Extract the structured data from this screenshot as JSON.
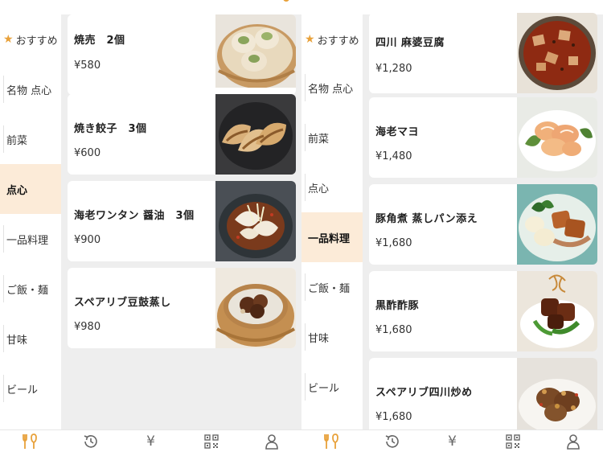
{
  "left": {
    "sidebar": {
      "items": [
        {
          "label": "おすすめ",
          "starred": true
        },
        {
          "label": "名物 点心"
        },
        {
          "label": "前菜"
        },
        {
          "label": "点心",
          "active": true
        },
        {
          "label": "一品料理"
        },
        {
          "label": "ご飯・麺"
        },
        {
          "label": "甘味"
        },
        {
          "label": "ビール"
        }
      ]
    },
    "items": [
      {
        "name": "焼売　2個",
        "price": "¥580",
        "photo": "shumai-photo"
      },
      {
        "name": "焼き餃子　3個",
        "price": "¥600",
        "photo": "gyoza-photo"
      },
      {
        "name": "海老ワンタン 醤油　3個",
        "price": "¥900",
        "photo": "shrimp-wonton-photo"
      },
      {
        "name": "スペアリブ豆鼓蒸し",
        "price": "¥980",
        "photo": "spare-rib-steamed-photo"
      }
    ]
  },
  "right": {
    "sidebar": {
      "items": [
        {
          "label": "おすすめ",
          "starred": true
        },
        {
          "label": "名物 点心"
        },
        {
          "label": "前菜"
        },
        {
          "label": "点心"
        },
        {
          "label": "一品料理",
          "active": true
        },
        {
          "label": "ご飯・麺"
        },
        {
          "label": "甘味"
        },
        {
          "label": "ビール"
        }
      ]
    },
    "items": [
      {
        "name": "四川 麻婆豆腐",
        "price": "¥1,280",
        "photo": "mapo-tofu-photo"
      },
      {
        "name": "海老マヨ",
        "price": "¥1,480",
        "photo": "shrimp-mayo-photo"
      },
      {
        "name": "豚角煮 蒸しパン添え",
        "price": "¥1,680",
        "photo": "braised-pork-photo"
      },
      {
        "name": "黒酢酢豚",
        "price": "¥1,680",
        "photo": "black-vinegar-pork-photo"
      },
      {
        "name": "スペアリブ四川炒め",
        "price": "¥1,680",
        "photo": "sichuan-spare-rib-photo"
      }
    ]
  },
  "tabbar": {
    "tabs": [
      {
        "icon": "fork-knife-icon",
        "active": true
      },
      {
        "icon": "history-icon"
      },
      {
        "icon": "yen-icon",
        "glyph": "¥"
      },
      {
        "icon": "qr-code-icon"
      },
      {
        "icon": "account-icon"
      }
    ]
  },
  "colors": {
    "accent": "#e8a13a",
    "active_category_bg": "#fcebd8",
    "page_bg": "#eeeeee",
    "card_bg": "#ffffff"
  }
}
